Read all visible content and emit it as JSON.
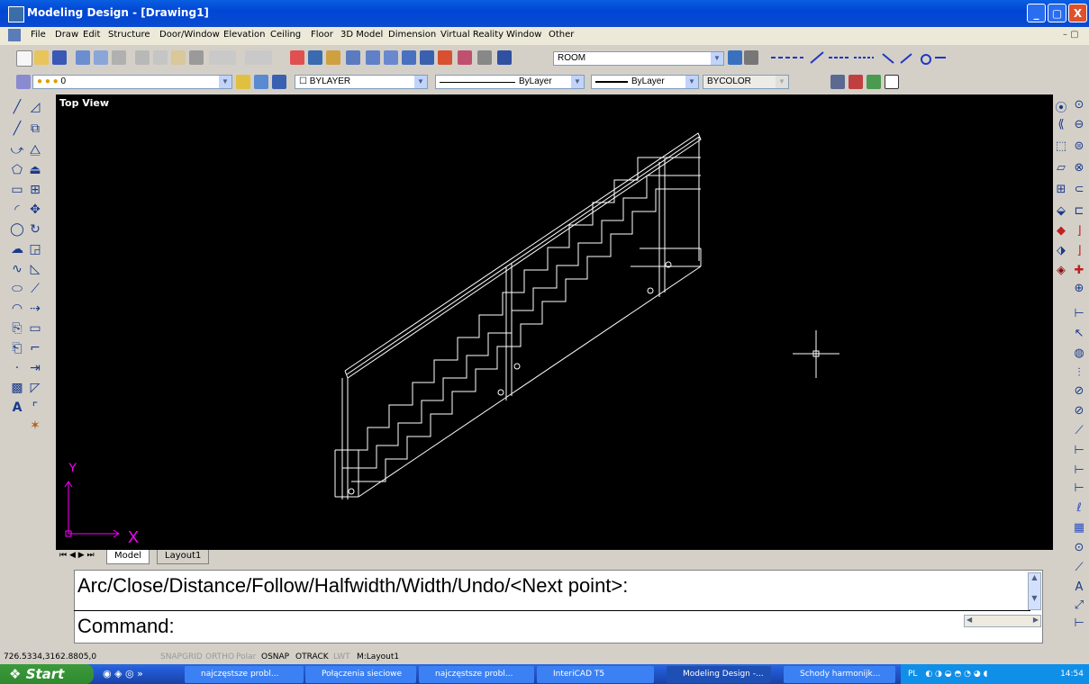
{
  "window": {
    "title": "Modeling Design - [Drawing1]",
    "min_label": "_",
    "max_label": "▢",
    "close_label": "X"
  },
  "menu": [
    "File",
    "Draw",
    "Edit",
    "Structure",
    "Door/Window",
    "Elevation",
    "Ceiling",
    "Floor",
    "3D Model",
    "Dimension",
    "Virtual Reality",
    "Window",
    "Other"
  ],
  "toolbar": {
    "room_combo": "ROOM",
    "layer_combo": "0",
    "color_combo": "BYLAYER",
    "linetype_combo": "ByLayer",
    "lineweight_combo": "ByLayer",
    "plotstyle_combo": "BYCOLOR"
  },
  "viewport": {
    "label": "Top View",
    "axis_x": "X",
    "axis_y": "Y"
  },
  "tabs": [
    "Model",
    "Layout1"
  ],
  "command": {
    "line1": "Arc/Close/Distance/Follow/Halfwidth/Width/Undo/<Next point>:",
    "line2": "Command:"
  },
  "status": {
    "coords": "726.5334,3162.8805,0",
    "toggles": [
      {
        "label": "SNAP",
        "on": false
      },
      {
        "label": "GRID",
        "on": false
      },
      {
        "label": "ORTHO",
        "on": false
      },
      {
        "label": "Polar",
        "on": false
      },
      {
        "label": "OSNAP",
        "on": true
      },
      {
        "label": "OTRACK",
        "on": true
      },
      {
        "label": "LWT",
        "on": false
      },
      {
        "label": "M:Layout1",
        "on": true
      }
    ]
  },
  "taskbar": {
    "start": "Start",
    "items": [
      "najczęstsze probl...",
      "Połączenia sieciowe",
      "najczęstsze probl...",
      "InteriCAD T5",
      "Modeling Design -...",
      "Schody harmonijk..."
    ],
    "lang": "PL",
    "clock": "14:54"
  },
  "colors": {
    "titlebar": "#0a4ad0",
    "canvas": "#000000",
    "drawing": "#ffffff",
    "axis": "#ff00ff"
  }
}
